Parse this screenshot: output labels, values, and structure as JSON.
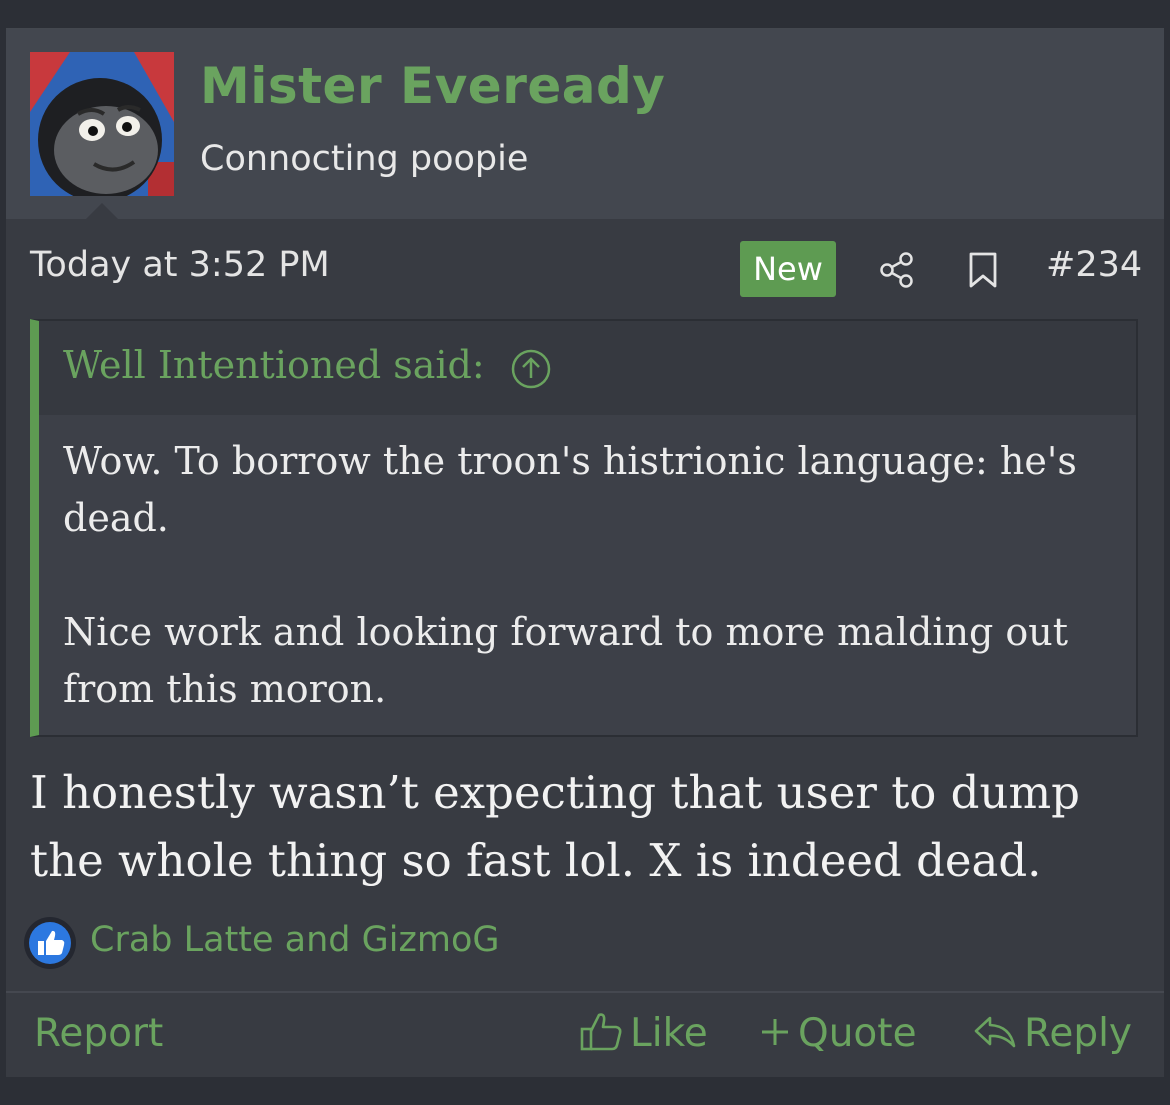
{
  "user": {
    "name": "Mister Eveready",
    "title": "Connocting poopie",
    "avatar_icon": "train-face-avatar"
  },
  "meta": {
    "date": "Today at 3:52 PM",
    "badge": "New",
    "post_number": "#234",
    "icons": [
      "share-icon",
      "bookmark-icon"
    ]
  },
  "quote": {
    "author": "Well Intentioned said:",
    "paragraphs": [
      "Wow. To borrow the troon's histrionic language: he's dead.",
      "Nice work and looking forward to more malding out from this moron."
    ]
  },
  "message": "I honestly wasn’t expecting that user to dump the whole thing so fast lol. X is indeed dead.",
  "reactions": {
    "icon": "thumbs-up-icon",
    "users": "Crab Latte and GizmoG"
  },
  "footer": {
    "report": "Report",
    "like": "Like",
    "quote": "Quote",
    "reply": "Reply"
  },
  "colors": {
    "accent": "#6aa35f",
    "badge": "#5e9b52",
    "background": "#383b42",
    "header": "#43474f"
  }
}
